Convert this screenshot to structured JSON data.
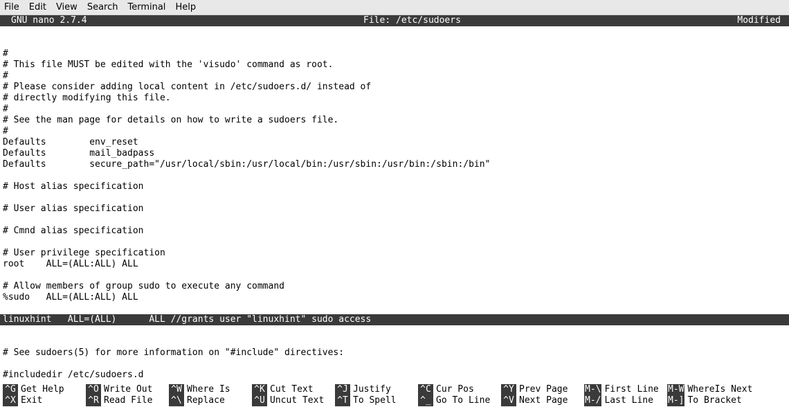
{
  "menu": {
    "items": [
      "File",
      "Edit",
      "View",
      "Search",
      "Terminal",
      "Help"
    ]
  },
  "header": {
    "app": "GNU nano 2.7.4",
    "file_label": "File: /etc/sudoers",
    "status": "Modified"
  },
  "editor": {
    "lines": [
      {
        "text": ""
      },
      {
        "text": ""
      },
      {
        "text": "#"
      },
      {
        "text": "# This file MUST be edited with the 'visudo' command as root."
      },
      {
        "text": "#"
      },
      {
        "text": "# Please consider adding local content in /etc/sudoers.d/ instead of"
      },
      {
        "text": "# directly modifying this file."
      },
      {
        "text": "#"
      },
      {
        "text": "# See the man page for details on how to write a sudoers file."
      },
      {
        "text": "#"
      },
      {
        "text": "Defaults        env_reset"
      },
      {
        "text": "Defaults        mail_badpass"
      },
      {
        "text": "Defaults        secure_path=\"/usr/local/sbin:/usr/local/bin:/usr/sbin:/usr/bin:/sbin:/bin\""
      },
      {
        "text": ""
      },
      {
        "text": "# Host alias specification"
      },
      {
        "text": ""
      },
      {
        "text": "# User alias specification"
      },
      {
        "text": ""
      },
      {
        "text": "# Cmnd alias specification"
      },
      {
        "text": ""
      },
      {
        "text": "# User privilege specification"
      },
      {
        "text": "root    ALL=(ALL:ALL) ALL"
      },
      {
        "text": ""
      },
      {
        "text": "# Allow members of group sudo to execute any command"
      },
      {
        "text": "%sudo   ALL=(ALL:ALL) ALL"
      },
      {
        "text": ""
      },
      {
        "text": "linuxhint   ALL=(ALL)      ALL //grants user \"linuxhint\" sudo access",
        "highlight": true
      },
      {
        "text": ""
      },
      {
        "text": ""
      },
      {
        "text": "# See sudoers(5) for more information on \"#include\" directives:"
      },
      {
        "text": ""
      },
      {
        "text": "#includedir /etc/sudoers.d"
      }
    ]
  },
  "shortcuts": {
    "row1": [
      {
        "key": "^G",
        "desc": "Get Help"
      },
      {
        "key": "^O",
        "desc": "Write Out"
      },
      {
        "key": "^W",
        "desc": "Where Is"
      },
      {
        "key": "^K",
        "desc": "Cut Text"
      },
      {
        "key": "^J",
        "desc": "Justify"
      },
      {
        "key": "^C",
        "desc": "Cur Pos"
      },
      {
        "key": "^Y",
        "desc": "Prev Page"
      },
      {
        "key": "M-\\",
        "desc": "First Line"
      },
      {
        "key": "M-W",
        "desc": "WhereIs Next"
      }
    ],
    "row2": [
      {
        "key": "^X",
        "desc": "Exit"
      },
      {
        "key": "^R",
        "desc": "Read File"
      },
      {
        "key": "^\\",
        "desc": "Replace"
      },
      {
        "key": "^U",
        "desc": "Uncut Text"
      },
      {
        "key": "^T",
        "desc": "To Spell"
      },
      {
        "key": "^_",
        "desc": "Go To Line"
      },
      {
        "key": "^V",
        "desc": "Next Page"
      },
      {
        "key": "M-/",
        "desc": "Last Line"
      },
      {
        "key": "M-]",
        "desc": "To Bracket"
      }
    ]
  }
}
